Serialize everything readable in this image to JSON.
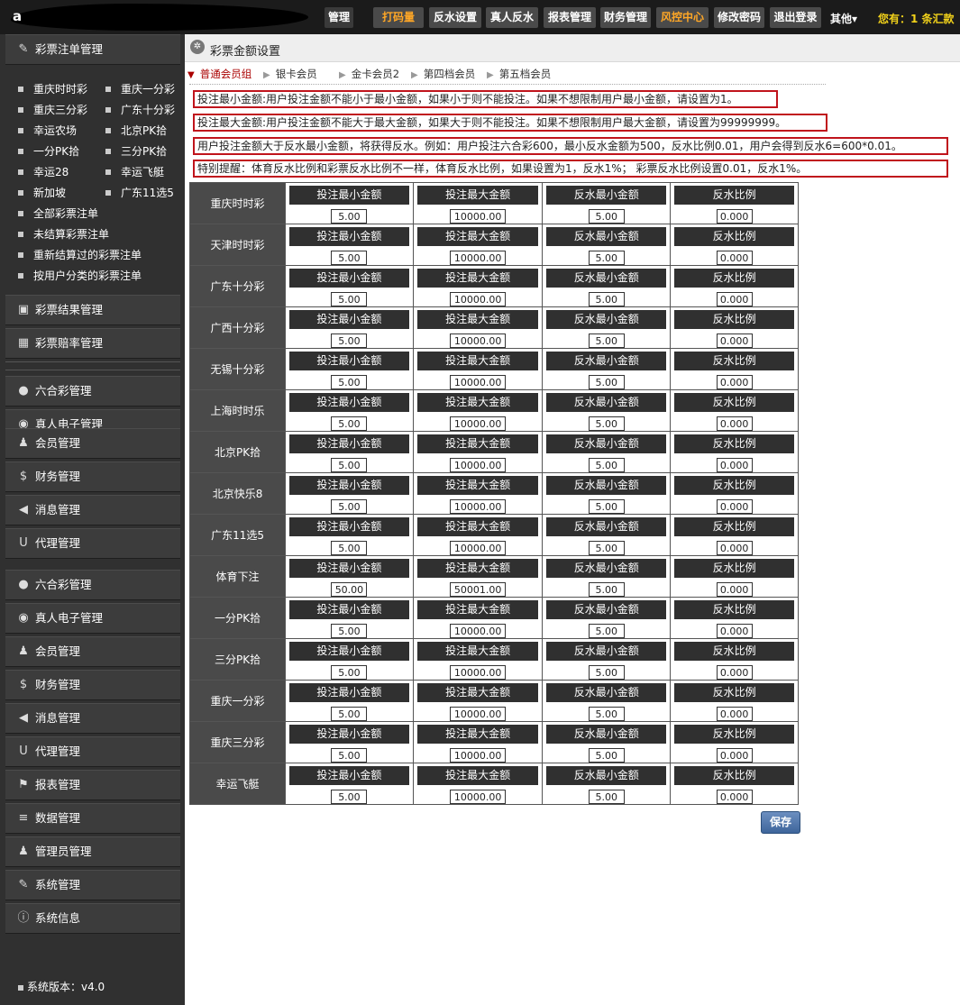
{
  "topbar": {
    "logo_letter": "a",
    "partial_button": "管理",
    "buttons": [
      {
        "label": "打码量",
        "highlight": true
      },
      {
        "label": "反水设置",
        "highlight": false
      },
      {
        "label": "真人反水",
        "highlight": false
      },
      {
        "label": "报表管理",
        "highlight": false
      },
      {
        "label": "财务管理",
        "highlight": false
      },
      {
        "label": "风控中心",
        "highlight": true
      },
      {
        "label": "修改密码",
        "highlight": false
      },
      {
        "label": "退出登录",
        "highlight": false
      }
    ],
    "other_label": "其他▾",
    "status_text": "您有：1 条汇款"
  },
  "sidebar": {
    "lottery_bet_title": "彩票注单管理",
    "lottery_items": [
      "重庆时时彩",
      "重庆一分彩",
      "重庆三分彩",
      "广东十分彩",
      "幸运农场",
      "北京PK拾",
      "一分PK拾",
      "三分PK拾",
      "幸运28",
      "幸运飞艇",
      "新加坡",
      "广东11选5"
    ],
    "lottery_single_items": [
      "全部彩票注单",
      "未结算彩票注单",
      "重新结算过的彩票注单",
      "按用户分类的彩票注单"
    ],
    "menus_a": [
      {
        "label": "彩票结果管理",
        "icon": "briefcase-icon",
        "glyph": "▣"
      },
      {
        "label": "彩票赔率管理",
        "icon": "calculator-icon",
        "glyph": "▦"
      }
    ],
    "menus_b": [
      {
        "label": "六合彩管理",
        "icon": "drop-icon",
        "glyph": "●"
      },
      {
        "label": "真人电子管理",
        "icon": "broadcast-icon",
        "glyph": "◉"
      },
      {
        "label": "会员管理",
        "icon": "users-icon",
        "glyph": "♟"
      },
      {
        "label": "财务管理",
        "icon": "dollar-icon",
        "glyph": "$"
      },
      {
        "label": "消息管理",
        "icon": "megaphone-icon",
        "glyph": "◀"
      },
      {
        "label": "代理管理",
        "icon": "magnet-icon",
        "glyph": "U"
      },
      {
        "label": "六合彩管理",
        "icon": "drop-icon",
        "glyph": "●"
      },
      {
        "label": "真人电子管理",
        "icon": "broadcast-icon",
        "glyph": "◉"
      },
      {
        "label": "会员管理",
        "icon": "users-icon",
        "glyph": "♟"
      },
      {
        "label": "财务管理",
        "icon": "dollar-icon",
        "glyph": "$"
      },
      {
        "label": "消息管理",
        "icon": "megaphone-icon",
        "glyph": "◀"
      },
      {
        "label": "代理管理",
        "icon": "magnet-icon",
        "glyph": "U"
      },
      {
        "label": "报表管理",
        "icon": "flag-icon",
        "glyph": "⚑"
      },
      {
        "label": "数据管理",
        "icon": "database-icon",
        "glyph": "≡"
      },
      {
        "label": "管理员管理",
        "icon": "admin-icon",
        "glyph": "♟"
      },
      {
        "label": "系统管理",
        "icon": "wrench-icon",
        "glyph": "✎"
      },
      {
        "label": "系统信息",
        "icon": "info-icon",
        "glyph": "ⓘ"
      }
    ],
    "version": "系统版本：v4.0"
  },
  "main": {
    "title": "彩票金额设置",
    "tabs": [
      "普通会员组",
      "银卡会员",
      "金卡会员2",
      "第四档会员",
      "第五档会员"
    ],
    "notices": [
      "投注最小金额:用户投注金额不能小于最小金额，如果小于则不能投注。如果不想限制用户最小金额，请设置为1。",
      "投注最大金额:用户投注金额不能大于最大金额，如果大于则不能投注。如果不想限制用户最大金额，请设置为99999999。",
      "用户投注金额大于反水最小金额，将获得反水。例如：用户投注六合彩600，最小反水金额为500，反水比例0.01，用户会得到反水6=600*0.01。",
      "特别提醒：体育反水比例和彩票反水比例不一样，体育反水比例，如果设置为1，反水1%； 彩票反水比例设置0.01，反水1%。"
    ],
    "column_labels": [
      "投注最小金额",
      "投注最大金额",
      "反水最小金额",
      "反水比例"
    ],
    "rows": [
      {
        "name": "重庆时时彩",
        "values": [
          "5.00",
          "10000.00",
          "5.00",
          "0.000"
        ]
      },
      {
        "name": "天津时时彩",
        "values": [
          "5.00",
          "10000.00",
          "5.00",
          "0.000"
        ]
      },
      {
        "name": "广东十分彩",
        "values": [
          "5.00",
          "10000.00",
          "5.00",
          "0.000"
        ]
      },
      {
        "name": "广西十分彩",
        "values": [
          "5.00",
          "10000.00",
          "5.00",
          "0.000"
        ]
      },
      {
        "name": "无锡十分彩",
        "values": [
          "5.00",
          "10000.00",
          "5.00",
          "0.000"
        ]
      },
      {
        "name": "上海时时乐",
        "values": [
          "5.00",
          "10000.00",
          "5.00",
          "0.000"
        ]
      },
      {
        "name": "北京PK拾",
        "values": [
          "5.00",
          "10000.00",
          "5.00",
          "0.000"
        ]
      },
      {
        "name": "北京快乐8",
        "values": [
          "5.00",
          "10000.00",
          "5.00",
          "0.000"
        ]
      },
      {
        "name": "广东11选5",
        "values": [
          "5.00",
          "10000.00",
          "5.00",
          "0.000"
        ]
      },
      {
        "name": "体育下注",
        "values": [
          "50.00",
          "50001.00",
          "5.00",
          "0.000"
        ]
      },
      {
        "name": "一分PK拾",
        "values": [
          "5.00",
          "10000.00",
          "5.00",
          "0.000"
        ]
      },
      {
        "name": "三分PK拾",
        "values": [
          "5.00",
          "10000.00",
          "5.00",
          "0.000"
        ]
      },
      {
        "name": "重庆一分彩",
        "values": [
          "5.00",
          "10000.00",
          "5.00",
          "0.000"
        ]
      },
      {
        "name": "重庆三分彩",
        "values": [
          "5.00",
          "10000.00",
          "5.00",
          "0.000"
        ]
      },
      {
        "name": "幸运飞艇",
        "values": [
          "5.00",
          "10000.00",
          "5.00",
          "0.000"
        ]
      }
    ],
    "save_label": "保存"
  }
}
